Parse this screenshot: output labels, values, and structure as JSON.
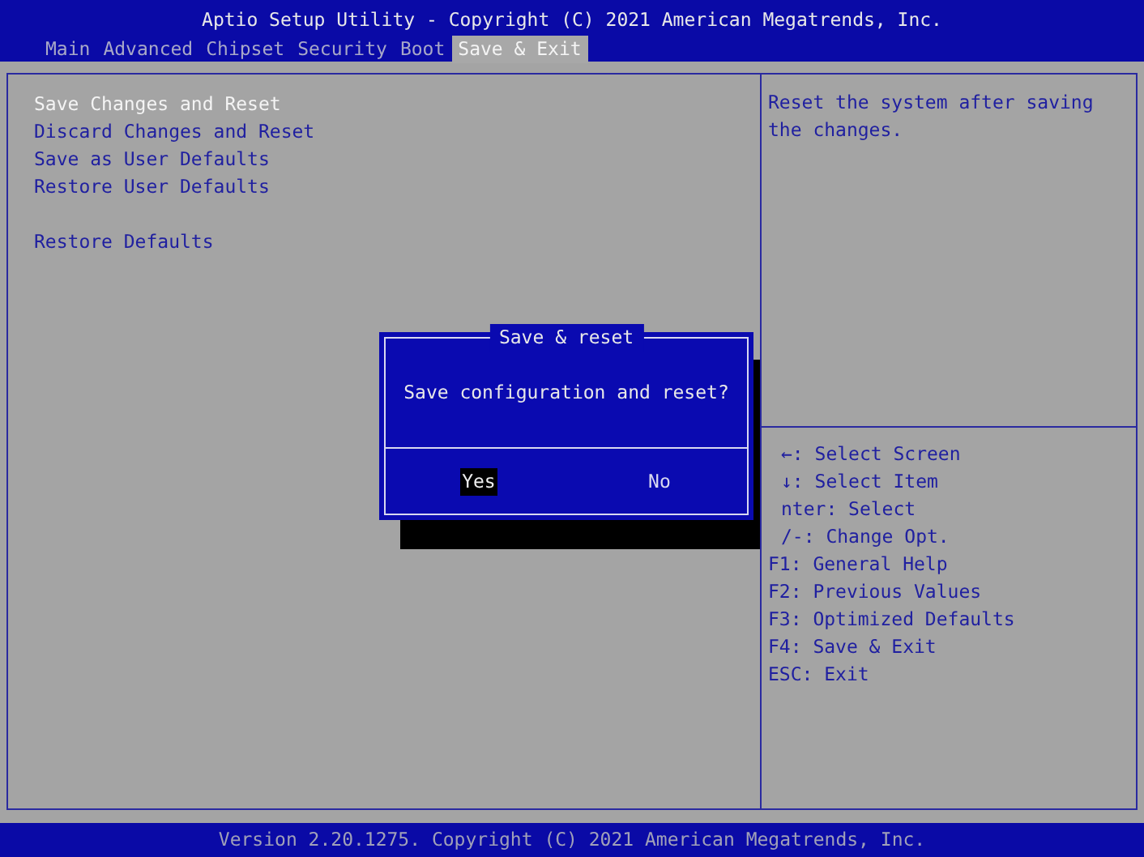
{
  "header": {
    "title": "Aptio Setup Utility - Copyright (C) 2021 American Megatrends, Inc."
  },
  "tabs": [
    {
      "label": "Main",
      "selected": false
    },
    {
      "label": "Advanced",
      "selected": false
    },
    {
      "label": "Chipset",
      "selected": false
    },
    {
      "label": "Security",
      "selected": false
    },
    {
      "label": "Boot",
      "selected": false
    },
    {
      "label": "Save & Exit",
      "selected": true
    }
  ],
  "menu_groups": [
    {
      "items": [
        {
          "label": "Save Changes and Reset",
          "selected": true
        },
        {
          "label": "Discard Changes and Reset",
          "selected": false
        },
        {
          "label": "Save as User Defaults",
          "selected": false
        },
        {
          "label": "Restore User Defaults",
          "selected": false
        }
      ]
    },
    {
      "items": [
        {
          "label": "Restore Defaults",
          "selected": false
        }
      ]
    }
  ],
  "help_text": "Reset the system after saving the changes.",
  "key_help": [
    "←: Select Screen",
    "↓: Select Item",
    "nter: Select",
    "/-: Change Opt.",
    "F1: General Help",
    "F2: Previous Values",
    "F3: Optimized Defaults",
    "F4: Save & Exit",
    "ESC: Exit"
  ],
  "dialog": {
    "title": "Save & reset",
    "message": "Save configuration and reset?",
    "buttons": [
      {
        "label": "Yes",
        "selected": true
      },
      {
        "label": "No",
        "selected": false
      }
    ]
  },
  "footer": "Version 2.20.1275. Copyright (C) 2021 American Megatrends, Inc."
}
